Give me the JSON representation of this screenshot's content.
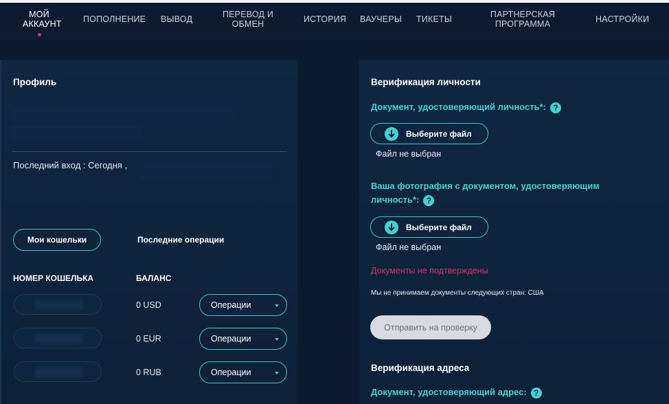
{
  "nav": {
    "my_account": "МОЙ АККАУНТ",
    "deposit": "ПОПОЛНЕНИЕ",
    "withdraw": "ВЫВОД",
    "transfer_line1": "ПЕРЕВОД И",
    "transfer_line2": "ОБМЕН",
    "history": "ИСТОРИЯ",
    "vouchers": "ВАУЧЕРЫ",
    "tickets": "ТИКЕТЫ",
    "partner_line1": "ПАРТНЕРСКАЯ",
    "partner_line2": "ПРОГРАММА",
    "settings": "НАСТРОЙКИ"
  },
  "profile": {
    "title": "Профиль",
    "last_login": "Последний вход : Сегодня ,",
    "tab_wallets": "Мои кошельки",
    "tab_operations": "Последние операции",
    "col_wallet_number": "НОМЕР КОШЕЛЬКА",
    "col_balance": "БАЛАНС",
    "wallets": [
      {
        "balance": "0 USD",
        "action": "Операции"
      },
      {
        "balance": "0 EUR",
        "action": "Операции"
      },
      {
        "balance": "0 RUB",
        "action": "Операции"
      }
    ]
  },
  "verification": {
    "title": "Верификация личности",
    "doc_label": "Документ, удостоверяющий личность*:",
    "doc_button": "Выберите файл",
    "doc_status": "Файл не выбран",
    "photo_label_line1": "Ваша фотография с документом, удостоверяющим",
    "photo_label_line2": "личность*:",
    "photo_button": "Выберите файл",
    "photo_status": "Файл не выбран",
    "not_confirmed": "Документы не подтверждены",
    "countries_note": "Мы не принимаем документы следующих стран: США",
    "submit": "Отправить на проверку",
    "address_title": "Верификация адреса",
    "address_doc_label": "Документ, удостоверяющий адрес:"
  },
  "help_glyph": "?",
  "colors": {
    "accent": "#3fd4d2",
    "danger": "#d6356e",
    "background": "#0b1a2e"
  }
}
